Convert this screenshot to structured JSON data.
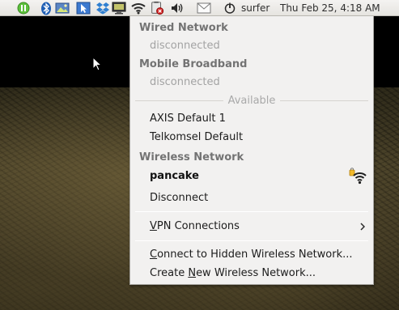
{
  "panel": {
    "username": "surfer",
    "datetime": "Thu Feb 25,  4:18 AM",
    "tray_icons": [
      "pause-icon",
      "bluetooth-icon",
      "image-viewer-icon",
      "pointer-tool-icon",
      "dropbox-icon",
      "monitor-icon",
      "wifi-icon",
      "battery-critical-icon",
      "volume-icon",
      "mail-icon",
      "power-icon"
    ]
  },
  "network_menu": {
    "wired_header": "Wired Network",
    "wired_status": "disconnected",
    "mobile_header": "Mobile Broadband",
    "mobile_status": "disconnected",
    "available_label": "Available",
    "mobile_connections": [
      "AXIS Default 1",
      "Telkomsel Default"
    ],
    "wireless_header": "Wireless Network",
    "active_network": "pancake",
    "disconnect_label": "Disconnect",
    "vpn": {
      "prefix": "",
      "mnemonic": "V",
      "rest": "PN Connections"
    },
    "hidden": {
      "prefix": "",
      "mnemonic": "C",
      "rest": "onnect to Hidden Wireless Network..."
    },
    "create": {
      "prefix": "Create ",
      "mnemonic": "N",
      "rest": "ew Wireless Network..."
    },
    "accent_color": "#f2b92a"
  }
}
